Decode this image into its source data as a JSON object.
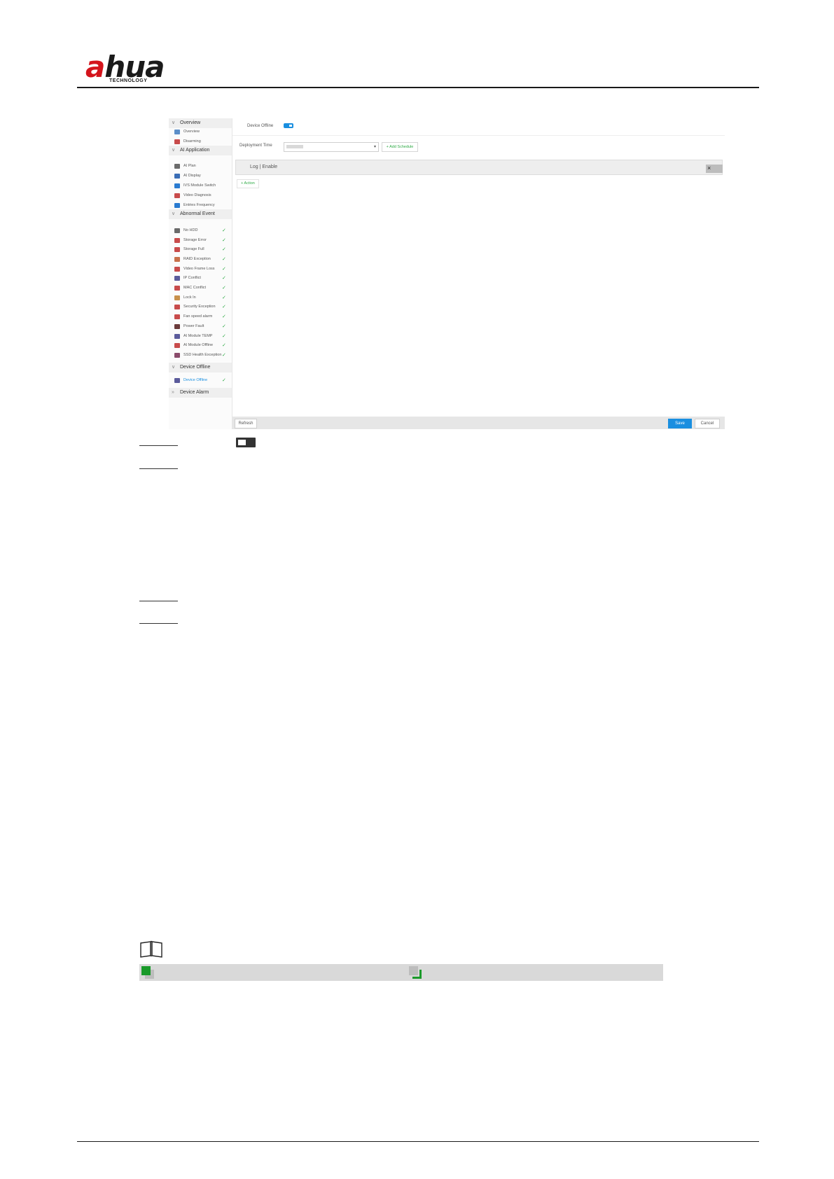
{
  "brand": {
    "logo_text_a": "a",
    "logo_text_b": "hua",
    "logo_tagline": "TECHNOLOGY"
  },
  "screenshot": {
    "sidebar": {
      "sections": [
        {
          "title": "Overview",
          "items": [
            {
              "label": "Overview",
              "check": false,
              "icon_color": "#5b8ec8"
            },
            {
              "label": "Disarming",
              "check": false,
              "icon_color": "#c84b4b"
            }
          ]
        },
        {
          "title": "AI Application",
          "items": [
            {
              "label": "AI Plan",
              "check": false,
              "icon_color": "#6a6a6a"
            },
            {
              "label": "AI Display",
              "check": false,
              "icon_color": "#3a6db5"
            },
            {
              "label": "IVS Module Switch",
              "check": false,
              "icon_color": "#2a7bd0"
            },
            {
              "label": "Video Diagnosis",
              "check": false,
              "icon_color": "#c84b4b"
            },
            {
              "label": "Entries Frequency",
              "check": false,
              "icon_color": "#2a7bd0"
            }
          ]
        },
        {
          "title": "Abnormal Event",
          "items": [
            {
              "label": "No HDD",
              "check": true,
              "icon_color": "#6a6a6a"
            },
            {
              "label": "Storage Error",
              "check": true,
              "icon_color": "#c84b4b"
            },
            {
              "label": "Storage Full",
              "check": true,
              "icon_color": "#c84b4b"
            },
            {
              "label": "RAID Exception",
              "check": true,
              "icon_color": "#c8704b"
            },
            {
              "label": "Video Frame Loss",
              "check": true,
              "icon_color": "#c84b4b"
            },
            {
              "label": "IP Conflict",
              "check": true,
              "icon_color": "#5b5b9b"
            },
            {
              "label": "MAC Conflict",
              "check": true,
              "icon_color": "#c84b4b"
            },
            {
              "label": "Lock In",
              "check": true,
              "icon_color": "#c8904b"
            },
            {
              "label": "Security Exception",
              "check": true,
              "icon_color": "#c84b4b"
            },
            {
              "label": "Fan speed alarm",
              "check": true,
              "icon_color": "#c84b4b"
            },
            {
              "label": "Power Fault",
              "check": true,
              "icon_color": "#6a3a3a"
            },
            {
              "label": "AI Module TEMP",
              "check": true,
              "icon_color": "#5b5b9b"
            },
            {
              "label": "AI Module Offline",
              "check": true,
              "icon_color": "#c84b4b"
            },
            {
              "label": "SSD Health Exception",
              "check": true,
              "icon_color": "#8a4b6b"
            }
          ]
        },
        {
          "title": "Device Offline",
          "items": [
            {
              "label": "Device Offline",
              "check": true,
              "active": true,
              "icon_color": "#5b5b9b"
            }
          ]
        },
        {
          "title": "Device Alarm",
          "items": []
        }
      ]
    },
    "main": {
      "device_offline_label": "Device Offline",
      "device_offline_enabled": true,
      "deployment_time_label": "Deployment Time",
      "deployment_time_value": "",
      "add_schedule_label": "+ Add Schedule",
      "log_label": "Log | Enable",
      "close_glyph": "×",
      "action_label": "+ Action",
      "refresh_label": "Refresh",
      "save_label": "Save",
      "cancel_label": "Cancel"
    }
  },
  "note_bar": {
    "left_color": "#1a9a2a",
    "right_color": "#1a9a2a"
  },
  "colors": {
    "accent": "#1a8fe0",
    "check": "#2eaa45",
    "brand_red": "#d4141c"
  }
}
